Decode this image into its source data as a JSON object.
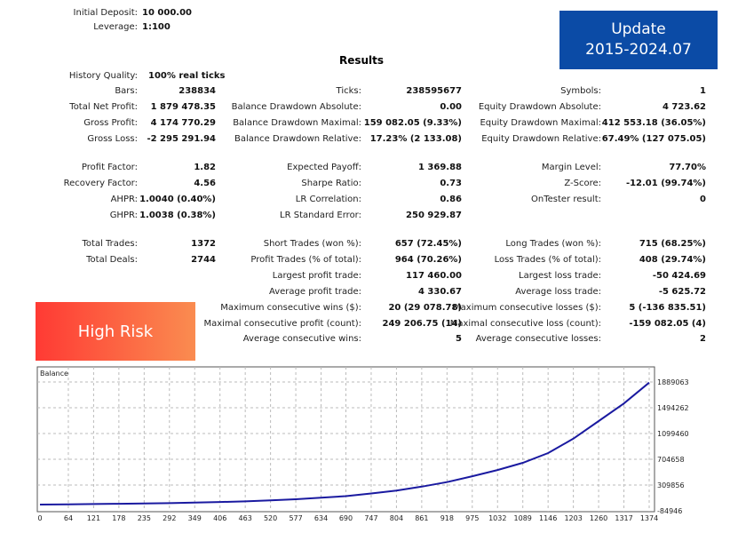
{
  "header": {
    "initial_deposit": {
      "label": "Initial Deposit:",
      "value": "10 000.00"
    },
    "leverage": {
      "label": "Leverage:",
      "value": "1:100"
    }
  },
  "results_title": "Results",
  "update_badge": {
    "line1": "Update",
    "line2": "2015-2024.07",
    "color": "#0b4ba6"
  },
  "risk_badge": {
    "label": "High Risk",
    "colors": [
      "#ff3a34",
      "#fa8c50"
    ]
  },
  "history_quality": {
    "label": "History Quality:",
    "value": "100% real ticks"
  },
  "rows": [
    [
      [
        "Bars:",
        "238834"
      ],
      [
        "Ticks:",
        "238595677"
      ],
      [
        "Symbols:",
        "1"
      ]
    ],
    [
      [
        "Total Net Profit:",
        "1 879 478.35"
      ],
      [
        "Balance Drawdown Absolute:",
        "0.00"
      ],
      [
        "Equity Drawdown Absolute:",
        "4 723.62"
      ]
    ],
    [
      [
        "Gross Profit:",
        "4 174 770.29"
      ],
      [
        "Balance Drawdown Maximal:",
        "159 082.05 (9.33%)"
      ],
      [
        "Equity Drawdown Maximal:",
        "412 553.18 (36.05%)"
      ]
    ],
    [
      [
        "Gross Loss:",
        "-2 295 291.94"
      ],
      [
        "Balance Drawdown Relative:",
        "17.23% (2 133.08)"
      ],
      [
        "Equity Drawdown Relative:",
        "67.49% (127 075.05)"
      ]
    ],
    [
      [
        "Profit Factor:",
        "1.82"
      ],
      [
        "Expected Payoff:",
        "1 369.88"
      ],
      [
        "Margin Level:",
        "77.70%"
      ]
    ],
    [
      [
        "Recovery Factor:",
        "4.56"
      ],
      [
        "Sharpe Ratio:",
        "0.73"
      ],
      [
        "Z-Score:",
        "-12.01 (99.74%)"
      ]
    ],
    [
      [
        "AHPR:",
        "1.0040 (0.40%)"
      ],
      [
        "LR Correlation:",
        "0.86"
      ],
      [
        "OnTester result:",
        "0"
      ]
    ],
    [
      [
        "GHPR:",
        "1.0038 (0.38%)"
      ],
      [
        "LR Standard Error:",
        "250 929.87"
      ],
      null
    ],
    [
      [
        "Total Trades:",
        "1372"
      ],
      [
        "Short Trades (won %):",
        "657 (72.45%)"
      ],
      [
        "Long Trades (won %):",
        "715 (68.25%)"
      ]
    ],
    [
      [
        "Total Deals:",
        "2744"
      ],
      [
        "Profit Trades (% of total):",
        "964 (70.26%)"
      ],
      [
        "Loss Trades (% of total):",
        "408 (29.74%)"
      ]
    ],
    [
      null,
      [
        "Largest profit trade:",
        "117 460.00"
      ],
      [
        "Largest loss trade:",
        "-50 424.69"
      ]
    ],
    [
      null,
      [
        "Average profit trade:",
        "4 330.67"
      ],
      [
        "Average loss trade:",
        "-5 625.72"
      ]
    ],
    [
      null,
      [
        "Maximum consecutive wins ($):",
        "20 (29 078.78)"
      ],
      [
        "Maximum consecutive losses ($):",
        "5 (-136 835.51)"
      ]
    ],
    [
      null,
      [
        "Maximal consecutive profit (count):",
        "249 206.75 (14)"
      ],
      [
        "Maximal consecutive loss (count):",
        "-159 082.05 (4)"
      ]
    ],
    [
      null,
      [
        "Average consecutive wins:",
        "5"
      ],
      [
        "Average consecutive losses:",
        "2"
      ]
    ]
  ],
  "chart_data": {
    "type": "line",
    "title": "Balance",
    "series": [
      {
        "name": "Balance",
        "color": "#1a1aa0",
        "x": [
          0,
          64,
          121,
          178,
          235,
          292,
          349,
          406,
          463,
          520,
          577,
          634,
          690,
          747,
          804,
          861,
          918,
          975,
          1032,
          1089,
          1146,
          1203,
          1260,
          1317,
          1374
        ],
        "y": [
          10000,
          14000,
          18000,
          22000,
          27000,
          32000,
          40000,
          50000,
          60000,
          75000,
          92000,
          115000,
          140000,
          180000,
          225000,
          285000,
          355000,
          445000,
          540000,
          650000,
          800000,
          1020000,
          1290000,
          1560000,
          1880000
        ]
      }
    ],
    "xticks": [
      0,
      64,
      121,
      178,
      235,
      292,
      349,
      406,
      463,
      520,
      577,
      634,
      690,
      747,
      804,
      861,
      918,
      975,
      1032,
      1089,
      1146,
      1203,
      1260,
      1317,
      1374
    ],
    "yticks": [
      1889063,
      1494262,
      1099460,
      704658,
      309856,
      -84946
    ],
    "xlim": [
      0,
      1390
    ],
    "ylim": [
      -84946,
      2000000
    ],
    "grid": true
  }
}
